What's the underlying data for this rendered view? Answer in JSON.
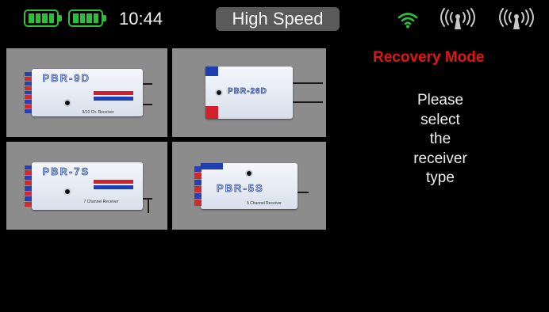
{
  "status_bar": {
    "battery_count": 2,
    "time": "10:44",
    "mode": "High Speed",
    "icons": [
      "battery-icon",
      "battery-icon",
      "wifi-icon",
      "antenna-icon",
      "antenna-icon"
    ]
  },
  "receivers": [
    {
      "id": "pbr-9d",
      "name": "PBR-9D",
      "subtitle": "9/10 Ch. Receiver"
    },
    {
      "id": "pbr-26d",
      "name": "PBR-26D",
      "subtitle": ""
    },
    {
      "id": "pbr-7s",
      "name": "PBR-7S",
      "subtitle": "7 Channel Receiver"
    },
    {
      "id": "pbr-5s",
      "name": "PBR-5S",
      "subtitle": "5 Channel Receiver"
    }
  ],
  "panel": {
    "title": "Recovery Mode",
    "instruction_lines": [
      "Please",
      "select",
      "the",
      "receiver",
      "type"
    ]
  },
  "colors": {
    "background": "#000000",
    "accent_green": "#2fbd3c",
    "title_red": "#e41414",
    "tile_gray": "#8c8c8c",
    "pill_gray": "#5a5a5a"
  }
}
